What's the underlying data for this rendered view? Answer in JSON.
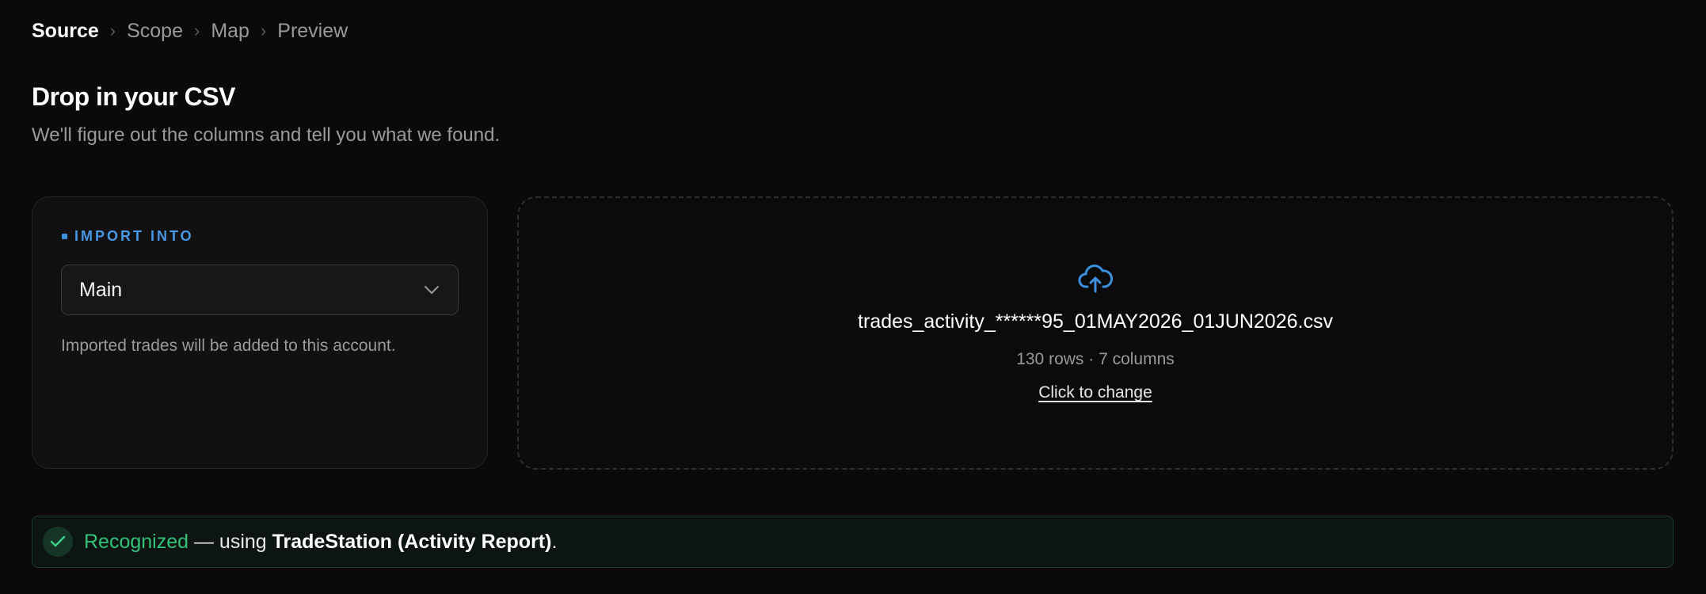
{
  "breadcrumb": {
    "steps": [
      "Source",
      "Scope",
      "Map",
      "Preview"
    ],
    "separator": "›",
    "active": "Source"
  },
  "header": {
    "title": "Drop in your CSV",
    "subtitle": "We'll figure out the columns and tell you what we found."
  },
  "import_card": {
    "section_label": "IMPORT INTO",
    "account_selected": "Main",
    "help_text": "Imported trades will be added to this account."
  },
  "dropzone": {
    "icon": "cloud-upload-icon",
    "file_name": "trades_activity_******95_01MAY2026_01JUN2026.csv",
    "file_meta": "130 rows · 7 columns",
    "change_label": "Click to change"
  },
  "status": {
    "icon": "check-icon",
    "recognized_label": "Recognized",
    "using_text": " — using ",
    "format_name": "TradeStation (Activity Report)",
    "trailing": "."
  },
  "colors": {
    "background": "#0a0a0a",
    "accent_blue": "#4a97e4",
    "success_green": "#34c27a"
  }
}
